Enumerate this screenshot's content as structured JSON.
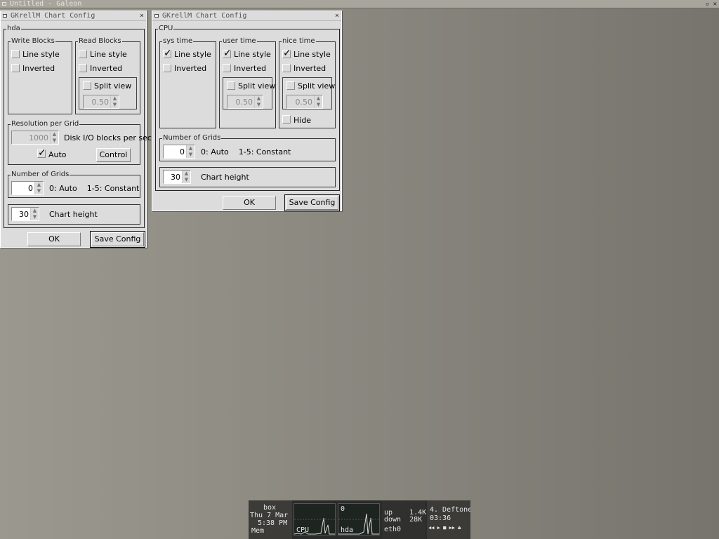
{
  "background_window": {
    "title": "Untitled - Galeon",
    "buttons": "▫ ✕"
  },
  "dialog_hda": {
    "title": "GKrellM Chart Config",
    "close": "×",
    "group_title": "hda",
    "write_blocks": {
      "title": "Write Blocks",
      "line_style": "Line style",
      "inverted": "Inverted"
    },
    "read_blocks": {
      "title": "Read Blocks",
      "line_style": "Line style",
      "inverted": "Inverted",
      "split_view": "Split view",
      "split_value": "0.50"
    },
    "resolution": {
      "title": "Resolution per Grid",
      "value": "1000",
      "unit": "Disk I/O blocks per sec",
      "auto_label": "Auto",
      "auto_checked": true,
      "control_label": "Control"
    },
    "grids": {
      "title": "Number of Grids",
      "value": "0",
      "hint": "0: Auto    1-5: Constant"
    },
    "chart_height": {
      "value": "30",
      "label": "Chart height"
    },
    "ok_label": "OK",
    "save_label": "Save Config"
  },
  "dialog_cpu": {
    "title": "GKrellM Chart Config",
    "close": "×",
    "group_title": "CPU",
    "sys_time": {
      "title": "sys time",
      "line_style": "Line style",
      "line_style_checked": true,
      "inverted": "Inverted"
    },
    "user_time": {
      "title": "user time",
      "line_style": "Line style",
      "line_style_checked": true,
      "inverted": "Inverted",
      "split_view": "Split view",
      "split_value": "0.50"
    },
    "nice_time": {
      "title": "nice time",
      "line_style": "Line style",
      "line_style_checked": true,
      "inverted": "Inverted",
      "split_view": "Split view",
      "split_value": "0.50",
      "hide": "Hide"
    },
    "grids": {
      "title": "Number of Grids",
      "value": "0",
      "hint": "0: Auto    1-5: Constant"
    },
    "chart_height": {
      "value": "30",
      "label": "Chart height"
    },
    "ok_label": "OK",
    "save_label": "Save Config"
  },
  "gkrellm": {
    "host": "box",
    "date": "Thu 7 Mar",
    "time": "5:38 PM",
    "mem_label": "Mem",
    "cpu_label": "CPU",
    "hda_label": "hda",
    "hda_value": "0",
    "net_up": "up    1.4K",
    "net_down": "down  28K",
    "net_label": "eth0",
    "track": "4. Deftone",
    "track_time": "03:36",
    "controls": "◀◀ ▶ ■ ▶▶ ⏏"
  }
}
